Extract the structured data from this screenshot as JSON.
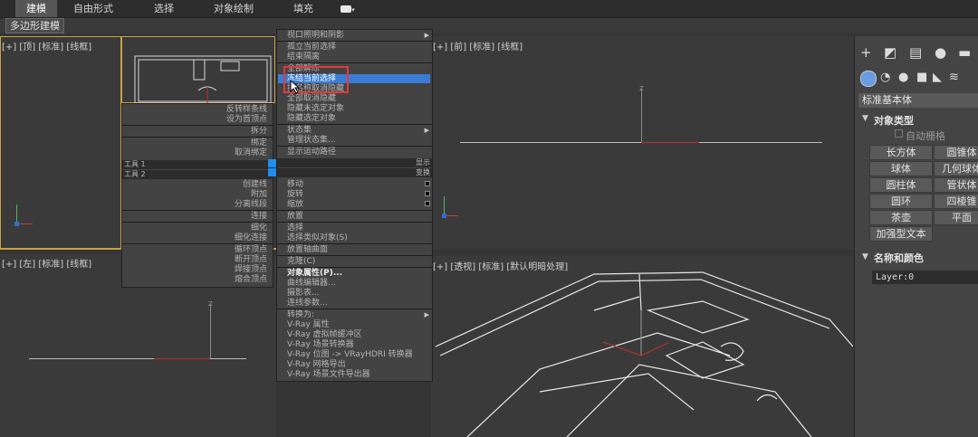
{
  "ribbon": {
    "tabs": [
      {
        "label": "建模",
        "active": true
      },
      {
        "label": "自由形式",
        "active": false
      },
      {
        "label": "选择",
        "active": false
      },
      {
        "label": "对象绘制",
        "active": false
      },
      {
        "label": "填充",
        "active": false
      }
    ],
    "subtab": "多边形建模"
  },
  "viewports": {
    "top": "[+] [顶] [标准] [线框]",
    "front": "[+] [前] [标准] [线框]",
    "left": "[+] [左] [标准] [线框]",
    "perspective": "[+] [透视] [标准] [默认明暗处理]"
  },
  "quad_left": {
    "items_top": [
      "反转样条线",
      "设为首顶点",
      "拆分",
      "绑定",
      "取消绑定"
    ],
    "tool1": "工具 1",
    "tool2": "工具 2",
    "right_tag1": "显示",
    "right_tag2": "变换",
    "items_bottom": [
      "创建线",
      "附加",
      "分离线段",
      "连接",
      "细化",
      "细化连接",
      "循环顶点",
      "断开顶点",
      "焊接顶点",
      "熔合顶点"
    ]
  },
  "quad_right": {
    "items": [
      {
        "label": "视口照明和阴影",
        "sub": true
      },
      {
        "label": "孤立当前选择"
      },
      {
        "label": "结束隔离"
      },
      {
        "label": "全部解冻"
      },
      {
        "label": "冻结当前选择",
        "highlight": true
      },
      {
        "label": "按名称取消隐藏"
      },
      {
        "label": "全部取消隐藏"
      },
      {
        "label": "隐藏未选定对象"
      },
      {
        "label": "隐藏选定对象"
      },
      {
        "label": "状态集",
        "sub": true
      },
      {
        "label": "管理状态集..."
      },
      {
        "label": "显示运动路径"
      },
      {
        "label": "移动",
        "box": true
      },
      {
        "label": "旋转",
        "box": true
      },
      {
        "label": "缩放",
        "box": true
      },
      {
        "label": "放置"
      },
      {
        "label": "选择"
      },
      {
        "label": "选择类似对象(S)"
      },
      {
        "label": "放置轴曲面"
      },
      {
        "label": "克隆(C)"
      },
      {
        "label": "对象属性(P)...",
        "bold": true
      },
      {
        "label": "曲线编辑器..."
      },
      {
        "label": "摄影表..."
      },
      {
        "label": "连线参数..."
      },
      {
        "label": "转换为:",
        "sub": true
      },
      {
        "label": "V-Ray 属性"
      },
      {
        "label": "V-Ray 虚拟帧缓冲区"
      },
      {
        "label": "V-Ray 场景转换器"
      },
      {
        "label": "V-Ray 位图 -> VRayHDRI 转换器"
      },
      {
        "label": "V-Ray 网格导出"
      },
      {
        "label": "V-Ray 场景文件导出器"
      }
    ]
  },
  "command_panel": {
    "dropdown": "标准基本体",
    "object_type_header": "对象类型",
    "autogrid": "自动栅格",
    "buttons": [
      [
        "长方体",
        "圆锥体"
      ],
      [
        "球体",
        "几何球体"
      ],
      [
        "圆柱体",
        "管状体"
      ],
      [
        "圆环",
        "四棱锥"
      ],
      [
        "茶壶",
        "平面"
      ],
      [
        "加强型文本",
        ""
      ]
    ],
    "name_color_header": "名称和颜色",
    "layer_field": "Layer:0"
  }
}
